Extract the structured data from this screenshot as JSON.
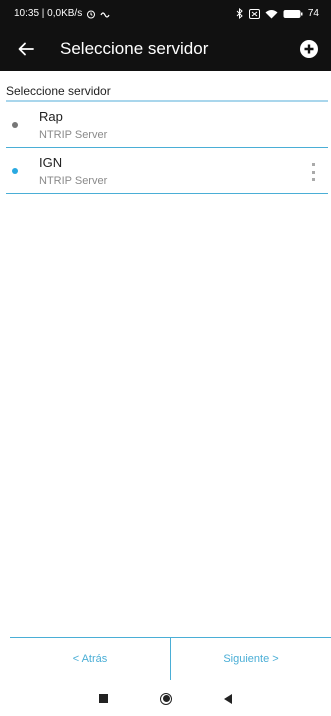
{
  "status_bar": {
    "time_speed": "10:35 | 0,0KB/s",
    "battery": "74"
  },
  "app_bar": {
    "title": "Seleccione servidor",
    "back_icon": "arrow-left-icon",
    "add_icon": "plus-circle-icon"
  },
  "section": {
    "header": "Seleccione servidor"
  },
  "servers": [
    {
      "name": "Rap",
      "type": "NTRIP Server",
      "dot_color": "#777777"
    },
    {
      "name": "IGN",
      "type": "NTRIP Server",
      "dot_color": "#29a9e1"
    }
  ],
  "bottom": {
    "back_label": "< Atrás",
    "next_label": "Siguiente >"
  },
  "colors": {
    "accent": "#4aaed6",
    "bar_bg": "#111111"
  }
}
